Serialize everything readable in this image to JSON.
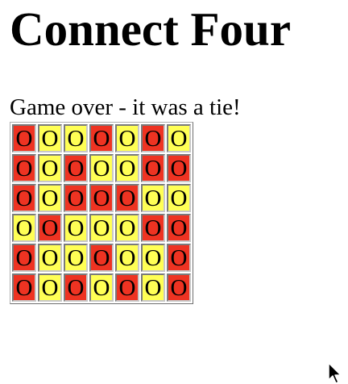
{
  "title": "Connect Four",
  "status": "Game over - it was a tie!",
  "colors": {
    "red": "#ee3322",
    "yellow": "#ffff55"
  },
  "board": {
    "rows": [
      [
        {
          "color": "red",
          "mark": "O"
        },
        {
          "color": "yellow",
          "mark": "O"
        },
        {
          "color": "yellow",
          "mark": "O"
        },
        {
          "color": "red",
          "mark": "O"
        },
        {
          "color": "yellow",
          "mark": "O"
        },
        {
          "color": "red",
          "mark": "O"
        },
        {
          "color": "yellow",
          "mark": "O"
        }
      ],
      [
        {
          "color": "red",
          "mark": "O"
        },
        {
          "color": "yellow",
          "mark": "O"
        },
        {
          "color": "red",
          "mark": "O"
        },
        {
          "color": "yellow",
          "mark": "O"
        },
        {
          "color": "yellow",
          "mark": "O"
        },
        {
          "color": "red",
          "mark": "O"
        },
        {
          "color": "red",
          "mark": "O"
        }
      ],
      [
        {
          "color": "red",
          "mark": "O"
        },
        {
          "color": "yellow",
          "mark": "O"
        },
        {
          "color": "red",
          "mark": "O"
        },
        {
          "color": "red",
          "mark": "O"
        },
        {
          "color": "red",
          "mark": "O"
        },
        {
          "color": "yellow",
          "mark": "O"
        },
        {
          "color": "yellow",
          "mark": "O"
        }
      ],
      [
        {
          "color": "yellow",
          "mark": "O"
        },
        {
          "color": "red",
          "mark": "O"
        },
        {
          "color": "yellow",
          "mark": "O"
        },
        {
          "color": "yellow",
          "mark": "O"
        },
        {
          "color": "yellow",
          "mark": "O"
        },
        {
          "color": "red",
          "mark": "O"
        },
        {
          "color": "red",
          "mark": "O"
        }
      ],
      [
        {
          "color": "red",
          "mark": "O"
        },
        {
          "color": "yellow",
          "mark": "O"
        },
        {
          "color": "yellow",
          "mark": "O"
        },
        {
          "color": "red",
          "mark": "O"
        },
        {
          "color": "yellow",
          "mark": "O"
        },
        {
          "color": "yellow",
          "mark": "O"
        },
        {
          "color": "red",
          "mark": "O"
        }
      ],
      [
        {
          "color": "red",
          "mark": "O"
        },
        {
          "color": "yellow",
          "mark": "O"
        },
        {
          "color": "red",
          "mark": "O"
        },
        {
          "color": "yellow",
          "mark": "O"
        },
        {
          "color": "red",
          "mark": "O"
        },
        {
          "color": "yellow",
          "mark": "O"
        },
        {
          "color": "red",
          "mark": "O"
        }
      ]
    ]
  },
  "cursor_icon": "arrow-cursor-icon"
}
